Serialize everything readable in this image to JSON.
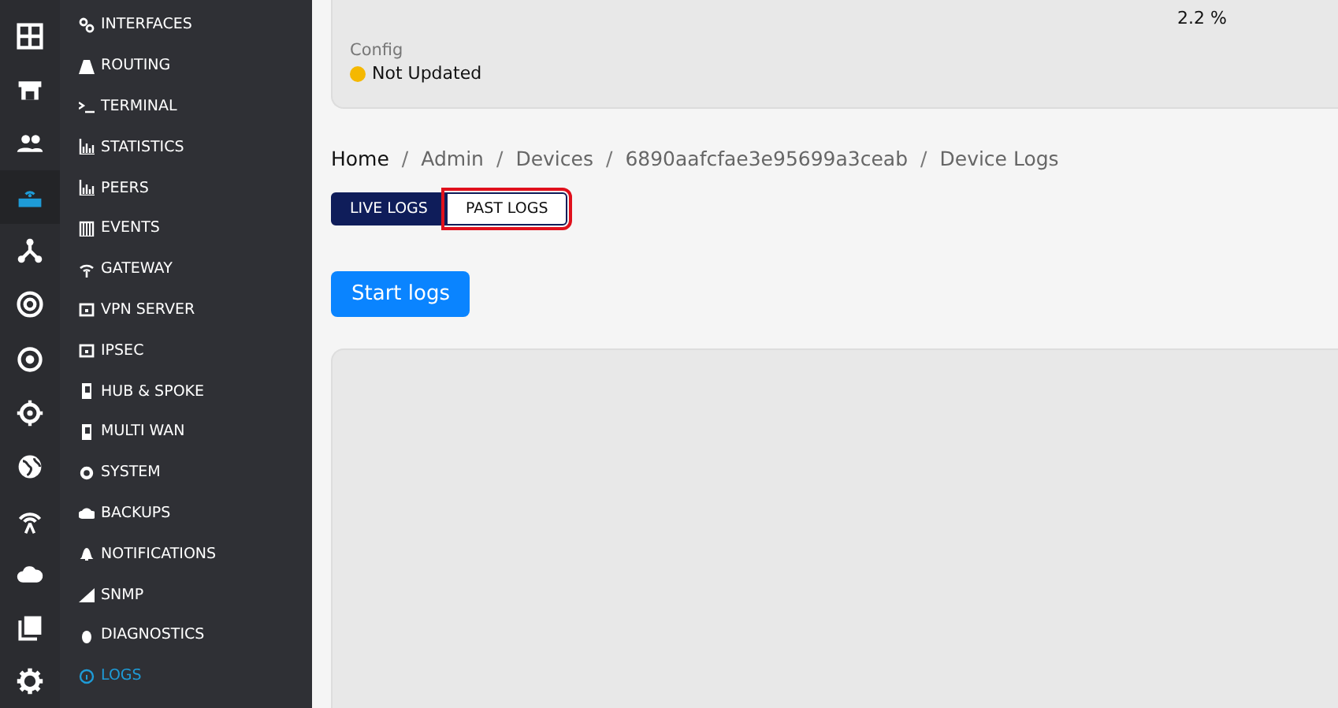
{
  "rail": [
    {
      "selected": false
    },
    {
      "selected": false
    },
    {
      "selected": false
    },
    {
      "selected": true
    },
    {
      "selected": false
    },
    {
      "selected": false
    },
    {
      "selected": false
    },
    {
      "selected": false
    },
    {
      "selected": false
    },
    {
      "selected": false
    },
    {
      "selected": false
    },
    {
      "selected": false
    },
    {
      "selected": false
    }
  ],
  "sidebar": {
    "items": [
      {
        "label": "INTERFACES",
        "selected": false
      },
      {
        "label": "ROUTING",
        "selected": false
      },
      {
        "label": "TERMINAL",
        "selected": false
      },
      {
        "label": "STATISTICS",
        "selected": false
      },
      {
        "label": "PEERS",
        "selected": false
      },
      {
        "label": "EVENTS",
        "selected": false
      },
      {
        "label": "GATEWAY",
        "selected": false
      },
      {
        "label": "VPN SERVER",
        "selected": false
      },
      {
        "label": "IPSEC",
        "selected": false
      },
      {
        "label": "HUB & SPOKE",
        "selected": false
      },
      {
        "label": "MULTI WAN",
        "selected": false
      },
      {
        "label": "SYSTEM",
        "selected": false
      },
      {
        "label": "BACKUPS",
        "selected": false
      },
      {
        "label": "NOTIFICATIONS",
        "selected": false
      },
      {
        "label": "SNMP",
        "selected": false
      },
      {
        "label": "DIAGNOSTICS",
        "selected": false
      },
      {
        "label": "LOGS",
        "selected": true
      }
    ]
  },
  "device_card": {
    "usage_value": "2.2 %",
    "config_label": "Config",
    "config_value": "Not Updated"
  },
  "breadcrumb": {
    "separator": "/",
    "items": [
      "Home",
      "Admin",
      "Devices",
      "6890aafcfae3e95699a3ceab",
      "Device Logs"
    ]
  },
  "tabs": [
    {
      "label": "LIVE LOGS",
      "selected": true
    },
    {
      "label": "PAST LOGS",
      "selected": false,
      "highlighted": true
    }
  ],
  "start_button": "Start logs"
}
